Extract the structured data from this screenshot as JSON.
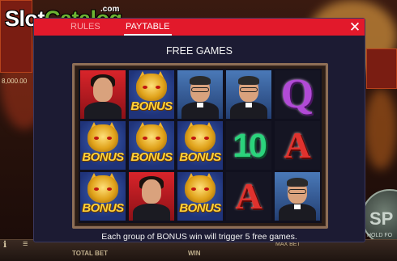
{
  "logo": {
    "slot": "Slot",
    "catalog": "Catalog",
    "domain": ".com"
  },
  "background": {
    "balance": "8,000.00",
    "spin_label": "SP",
    "spin_sub": "HOLD FO",
    "total_bet_label": "TOTAL BET",
    "win_label": "WIN",
    "max_bet_label": "MAX BET"
  },
  "modal": {
    "tabs": [
      {
        "label": "RULES",
        "active": false
      },
      {
        "label": "PAYTABLE",
        "active": true
      }
    ],
    "close_icon": "close-icon",
    "title": "FREE GAMES",
    "description": "Each group of BONUS win will trigger 5 free games."
  },
  "reels": {
    "bonus_text": "BONUS",
    "q_text": "Q",
    "ten_text": "10",
    "a_text": "A",
    "grid": [
      [
        "hero",
        "bonus",
        "priest",
        "priest",
        "Q"
      ],
      [
        "bonus",
        "bonus",
        "bonus",
        "10",
        "A"
      ],
      [
        "bonus",
        "hero",
        "bonus",
        "A",
        "priest"
      ]
    ]
  },
  "colors": {
    "header_red": "#e2192b",
    "modal_bg": "#1c1b33",
    "logo_green": "#6db332",
    "bonus_gold": "#ffd23d"
  }
}
